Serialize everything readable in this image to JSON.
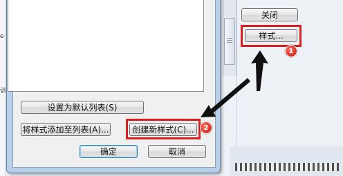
{
  "buttons": {
    "close": "关闭",
    "style": "样式...",
    "set_default": "设置为默认列表(S)",
    "add_style": "将样式添加至列表(A)...",
    "create_style": "创建新样式(C)...",
    "ok": "确定",
    "cancel": "取消"
  },
  "callouts": {
    "step1": "1",
    "step2": "2",
    "highlight_color": "#d91e1e"
  },
  "left_edge": {
    "glyph1": "e",
    "glyph2": "训"
  }
}
